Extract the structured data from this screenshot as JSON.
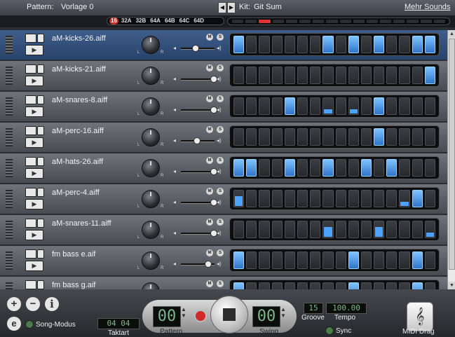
{
  "header": {
    "pattern_label": "Pattern:",
    "pattern_name": "Vorlage 0",
    "kit_label": "Kit:",
    "kit_name": "Git Sum",
    "more_sounds": "Mehr Sounds"
  },
  "banks": [
    {
      "label": "16",
      "active": true
    },
    {
      "label": "32A",
      "active": false
    },
    {
      "label": "32B",
      "active": false
    },
    {
      "label": "64A",
      "active": false
    },
    {
      "label": "64B",
      "active": false
    },
    {
      "label": "64C",
      "active": false
    },
    {
      "label": "64D",
      "active": false
    }
  ],
  "position_leds": {
    "count": 16,
    "active": 2
  },
  "tracks": [
    {
      "name": "aM-kicks-26.aiff",
      "volume": 0.42,
      "selected": true,
      "steps": [
        "on",
        "off",
        "off",
        "off",
        "off",
        "off",
        "off",
        "on",
        "off",
        "on",
        "off",
        "on",
        "off",
        "off",
        "on",
        "on"
      ]
    },
    {
      "name": "aM-kicks-21.aiff",
      "volume": 0.95,
      "selected": false,
      "steps": [
        "off",
        "off",
        "off",
        "off",
        "off",
        "off",
        "off",
        "off",
        "off",
        "off",
        "off",
        "off",
        "off",
        "off",
        "off",
        "on"
      ]
    },
    {
      "name": "aM-snares-8.aiff",
      "volume": 0.95,
      "selected": false,
      "steps": [
        "off",
        "off",
        "off",
        "off",
        "on",
        "off",
        "off",
        "part",
        "off",
        "part",
        "off",
        "on",
        "off",
        "off",
        "off",
        "off"
      ]
    },
    {
      "name": "aM-perc-16.aiff",
      "volume": 0.45,
      "selected": false,
      "steps": [
        "off",
        "off",
        "off",
        "off",
        "off",
        "off",
        "off",
        "off",
        "off",
        "off",
        "off",
        "on",
        "off",
        "off",
        "off",
        "off"
      ]
    },
    {
      "name": "aM-hats-26.aiff",
      "volume": 0.95,
      "selected": false,
      "steps": [
        "on",
        "on",
        "off",
        "off",
        "on",
        "off",
        "off",
        "on",
        "off",
        "off",
        "on",
        "off",
        "on",
        "off",
        "off",
        "off"
      ]
    },
    {
      "name": "aM-perc-4.aiff",
      "volume": 0.95,
      "selected": false,
      "steps": [
        "mid",
        "off",
        "off",
        "off",
        "off",
        "off",
        "off",
        "off",
        "off",
        "off",
        "off",
        "off",
        "off",
        "part",
        "on",
        "off"
      ]
    },
    {
      "name": "aM-snares-11.aiff",
      "volume": 0.95,
      "selected": false,
      "steps": [
        "off",
        "off",
        "off",
        "off",
        "off",
        "off",
        "off",
        "mid",
        "off",
        "off",
        "off",
        "mid",
        "off",
        "off",
        "off",
        "part"
      ]
    },
    {
      "name": "fm bass e.aif",
      "volume": 0.8,
      "selected": false,
      "steps": [
        "on",
        "off",
        "off",
        "off",
        "off",
        "off",
        "off",
        "off",
        "off",
        "on",
        "off",
        "off",
        "off",
        "off",
        "on",
        "off"
      ]
    },
    {
      "name": "fm bass g.aif",
      "volume": 0.95,
      "selected": false,
      "steps": [
        "on",
        "off",
        "off",
        "off",
        "off",
        "off",
        "off",
        "off",
        "off",
        "on",
        "off",
        "off",
        "off",
        "off",
        "on",
        "off"
      ]
    }
  ],
  "track_buttons": {
    "mute": "M",
    "solo": "S",
    "left": "L",
    "right": "R"
  },
  "bottom": {
    "song_mode_label": "Song-Modus",
    "time_signature_value": "04 04",
    "time_signature_label": "Taktart",
    "pattern_value": "00",
    "pattern_label": "Pattern",
    "swing_value": "00",
    "swing_label": "Swing",
    "groove_value": "15",
    "groove_label": "Groove",
    "tempo_value": "100.00",
    "tempo_label": "Tempo",
    "sync_label": "Sync",
    "midi_drag_label": "MIDI Drag"
  }
}
